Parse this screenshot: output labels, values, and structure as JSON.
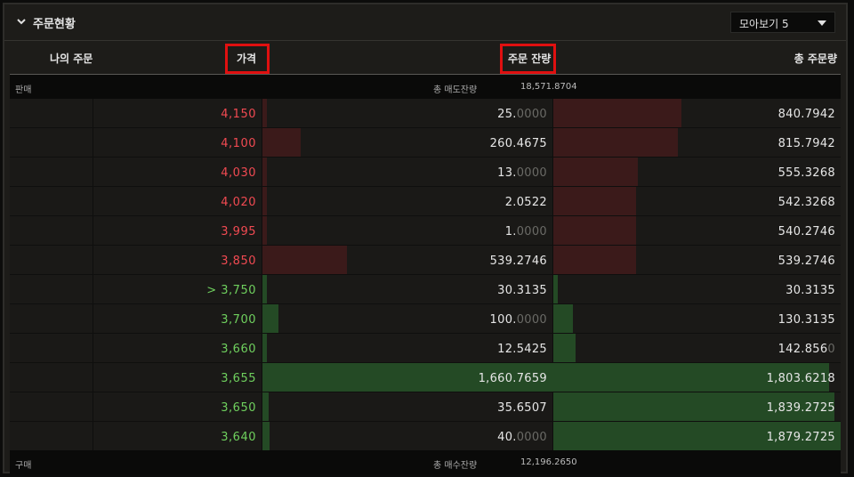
{
  "panel": {
    "title": "주문현황",
    "icon": "chevron-down-icon",
    "dropdown": {
      "selected": "모아보기 5"
    }
  },
  "columns": {
    "my_order": "나의 주문",
    "price": "가격",
    "remaining": "주문 잔량",
    "total": "총 주문량"
  },
  "sell": {
    "label": "판매",
    "total_label": "총 매도잔량",
    "total_value": "18,571.8704"
  },
  "buy": {
    "label": "구매",
    "total_label": "총 매수잔량",
    "total_value": "12,196.2650"
  },
  "colors": {
    "ask": "#f14a52",
    "bid": "#6fd05e",
    "ask_bar": "#3b1a1a",
    "bid_bar": "#244a25"
  },
  "rows": [
    {
      "side": "sell",
      "price": "4,150",
      "qty_main": "25.",
      "qty_dim": "0000",
      "total_main": "840.7942",
      "total_dim": "",
      "qty_level": 0.005,
      "total_level": 0.447
    },
    {
      "side": "sell",
      "price": "4,100",
      "qty_main": "260.4675",
      "qty_dim": "",
      "total_main": "815.7942",
      "total_dim": "",
      "qty_level": 0.13,
      "total_level": 0.434
    },
    {
      "side": "sell",
      "price": "4,030",
      "qty_main": "13.",
      "qty_dim": "0000",
      "total_main": "555.3268",
      "total_dim": "",
      "qty_level": 0.0,
      "total_level": 0.295
    },
    {
      "side": "sell",
      "price": "4,020",
      "qty_main": "2.0522",
      "qty_dim": "",
      "total_main": "542.3268",
      "total_dim": "",
      "qty_level": 0.0,
      "total_level": 0.288
    },
    {
      "side": "sell",
      "price": "3,995",
      "qty_main": "1.",
      "qty_dim": "0000",
      "total_main": "540.2746",
      "total_dim": "",
      "qty_level": 0.0,
      "total_level": 0.287
    },
    {
      "side": "sell",
      "price": "3,850",
      "qty_main": "539.2746",
      "qty_dim": "",
      "total_main": "539.2746",
      "total_dim": "",
      "qty_level": 0.29,
      "total_level": 0.287
    },
    {
      "side": "buy",
      "price": "> 3,750",
      "qty_main": "30.3135",
      "qty_dim": "",
      "total_main": "30.3135",
      "total_dim": "",
      "qty_level": 0.016,
      "total_level": 0.016
    },
    {
      "side": "buy",
      "price": "3,700",
      "qty_main": "100.",
      "qty_dim": "0000",
      "total_main": "130.3135",
      "total_dim": "",
      "qty_level": 0.055,
      "total_level": 0.069
    },
    {
      "side": "buy",
      "price": "3,660",
      "qty_main": "12.5425",
      "qty_dim": "",
      "total_main": "142.856",
      "total_dim": "0",
      "qty_level": 0.007,
      "total_level": 0.076
    },
    {
      "side": "buy",
      "price": "3,655",
      "qty_main": "1,660.7659",
      "qty_dim": "",
      "total_main": "1,803.6218",
      "total_dim": "",
      "qty_level": 1.0,
      "total_level": 0.96
    },
    {
      "side": "buy",
      "price": "3,650",
      "qty_main": "35.6507",
      "qty_dim": "",
      "total_main": "1,839.2725",
      "total_dim": "",
      "qty_level": 0.021,
      "total_level": 0.979
    },
    {
      "side": "buy",
      "price": "3,640",
      "qty_main": "40.",
      "qty_dim": "0000",
      "total_main": "1,879.2725",
      "total_dim": "",
      "qty_level": 0.024,
      "total_level": 1.0
    }
  ]
}
